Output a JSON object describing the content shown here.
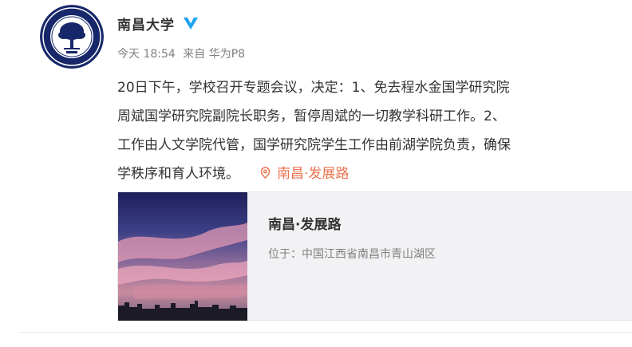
{
  "post": {
    "author": "南昌大学",
    "verified_color": "#1da1f2",
    "meta": {
      "time": "今天 18:54",
      "source": "来自 华为P8"
    },
    "text_lines": [
      "20日下午，学校召开专题会议，决定：1、免去程水金国学研究院",
      "周斌国学研究院副院长职务，暂停周斌的一切教学科研工作。2、",
      "工作由人文学院代管，国学研究院学生工作由前湖学院负责，确保",
      "学秩序和育人环境。"
    ],
    "location_link": "南昌·发展路",
    "location_icon": "location-pin-icon",
    "accent_color": "#eb7350"
  },
  "location_card": {
    "title": "南昌·发展路",
    "address": "位于：中国江西省南昌市青山湖区"
  }
}
